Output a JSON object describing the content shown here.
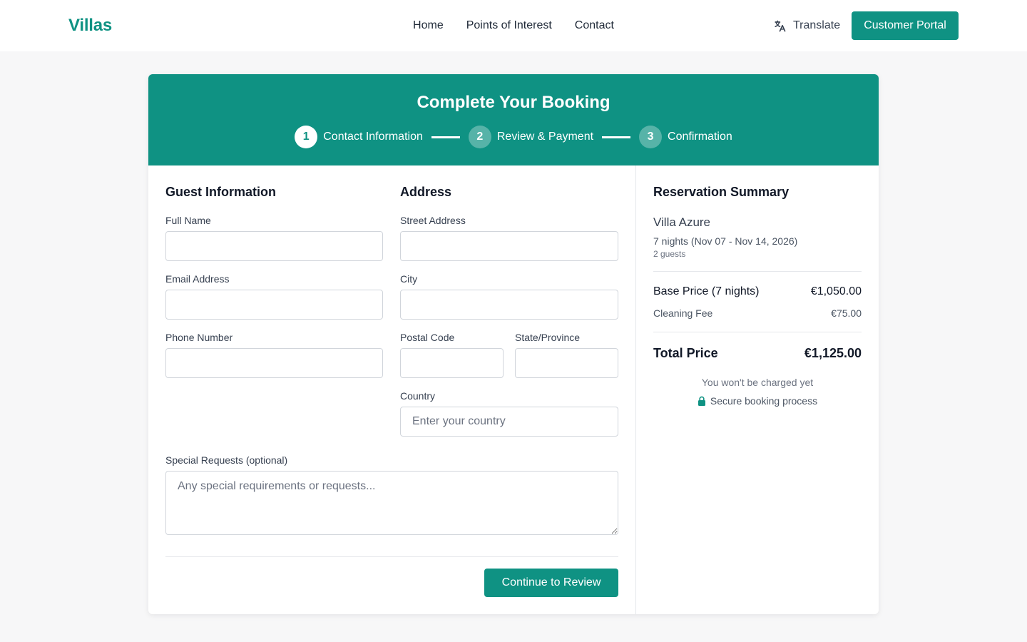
{
  "header": {
    "brand": "Villas",
    "nav": [
      "Home",
      "Points of Interest",
      "Contact"
    ],
    "translate_label": "Translate",
    "portal_label": "Customer Portal"
  },
  "booking": {
    "title": "Complete Your Booking",
    "steps": [
      {
        "num": "1",
        "label": "Contact Information",
        "active": true
      },
      {
        "num": "2",
        "label": "Review & Payment",
        "active": false
      },
      {
        "num": "3",
        "label": "Confirmation",
        "active": false
      }
    ]
  },
  "guest": {
    "title": "Guest Information",
    "full_name_label": "Full Name",
    "full_name_value": "",
    "email_label": "Email Address",
    "email_value": "",
    "phone_label": "Phone Number",
    "phone_value": ""
  },
  "address": {
    "title": "Address",
    "street_label": "Street Address",
    "street_value": "",
    "city_label": "City",
    "city_value": "",
    "postal_label": "Postal Code",
    "postal_value": "",
    "state_label": "State/Province",
    "state_value": "",
    "country_label": "Country",
    "country_placeholder": "Enter your country"
  },
  "requests": {
    "label": "Special Requests (optional)",
    "placeholder": "Any special requirements or requests..."
  },
  "continue_label": "Continue to Review",
  "summary": {
    "title": "Reservation Summary",
    "villa": "Villa Azure",
    "dates": "7 nights (Nov 07 - Nov 14, 2026)",
    "guests": "2 guests",
    "base_label": "Base Price (7 nights)",
    "base_value": "€1,050.00",
    "cleaning_label": "Cleaning Fee",
    "cleaning_value": "€75.00",
    "total_label": "Total Price",
    "total_value": "€1,125.00",
    "charge_note": "You won't be charged yet",
    "secure_note": "Secure booking process"
  },
  "colors": {
    "accent": "#0f9283",
    "background": "#f7f7f8"
  },
  "icons": {
    "translate": "translate-icon",
    "lock": "lock-icon"
  }
}
